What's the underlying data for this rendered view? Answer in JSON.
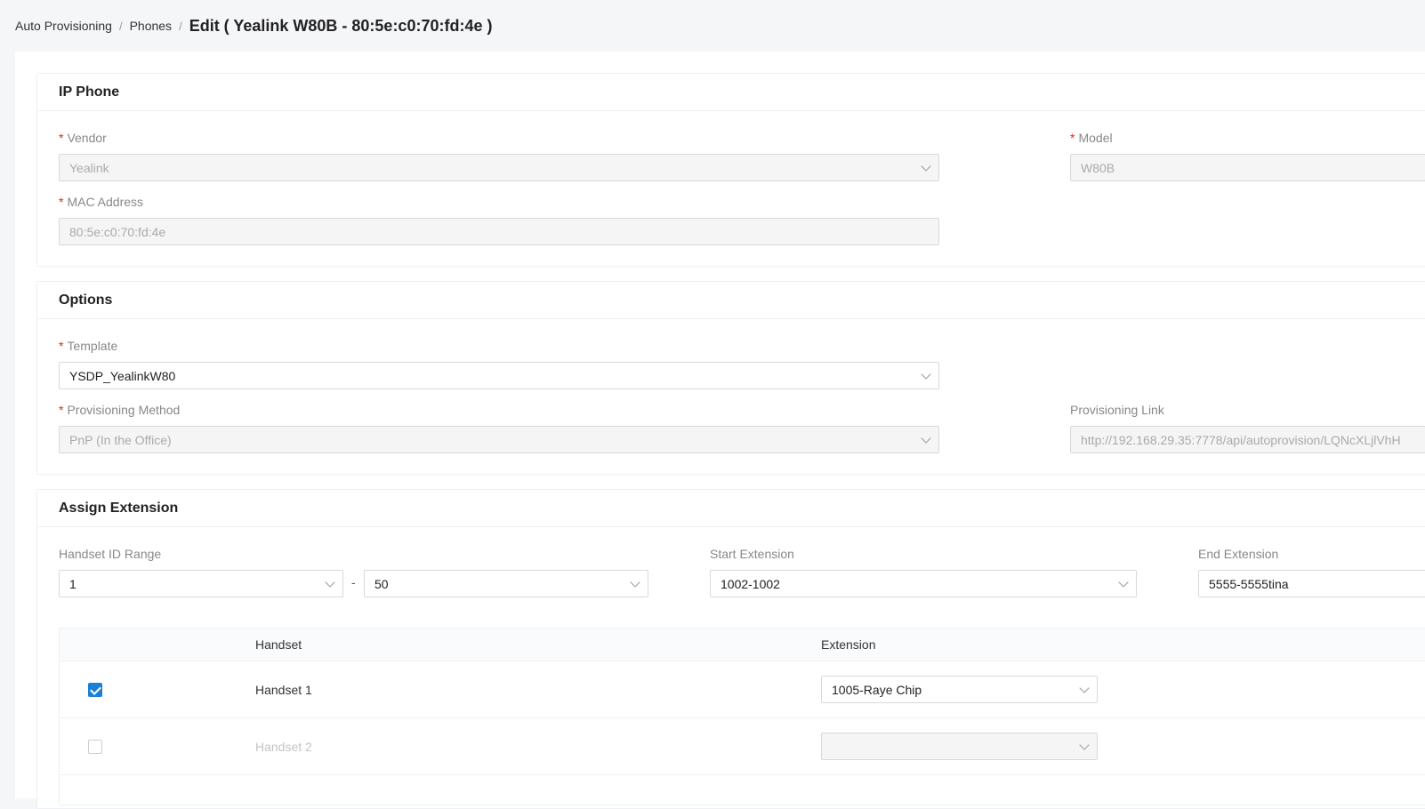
{
  "breadcrumb": {
    "items": [
      "Auto Provisioning",
      "Phones"
    ],
    "separator": "/",
    "current": "Edit ( Yealink W80B - 80:5e:c0:70:fd:4e )"
  },
  "ip_phone": {
    "title": "IP Phone",
    "vendor": {
      "label": "Vendor",
      "value": "Yealink"
    },
    "model": {
      "label": "Model",
      "value": "W80B"
    },
    "mac": {
      "label": "MAC Address",
      "value": "80:5e:c0:70:fd:4e"
    }
  },
  "options": {
    "title": "Options",
    "template": {
      "label": "Template",
      "value": "YSDP_YealinkW80"
    },
    "method": {
      "label": "Provisioning Method",
      "value": "PnP (In the Office)"
    },
    "link": {
      "label": "Provisioning Link",
      "value": "http://192.168.29.35:7778/api/autoprovision/LQNcXLjlVhH"
    }
  },
  "assign": {
    "title": "Assign Extension",
    "handset_range": {
      "label": "Handset ID Range",
      "from": "1",
      "to": "50",
      "dash": "-"
    },
    "start_ext": {
      "label": "Start Extension",
      "value": "1002-1002"
    },
    "end_ext": {
      "label": "End Extension",
      "value": "5555-5555tina"
    },
    "table": {
      "headers": {
        "handset": "Handset",
        "extension": "Extension"
      },
      "rows": [
        {
          "checked": true,
          "handset": "Handset 1",
          "extension": "1005-Raye Chip"
        },
        {
          "checked": false,
          "handset": "Handset 2",
          "extension": ""
        }
      ]
    }
  },
  "colors": {
    "required": "#e1251b",
    "accent": "#1b7fd6"
  }
}
